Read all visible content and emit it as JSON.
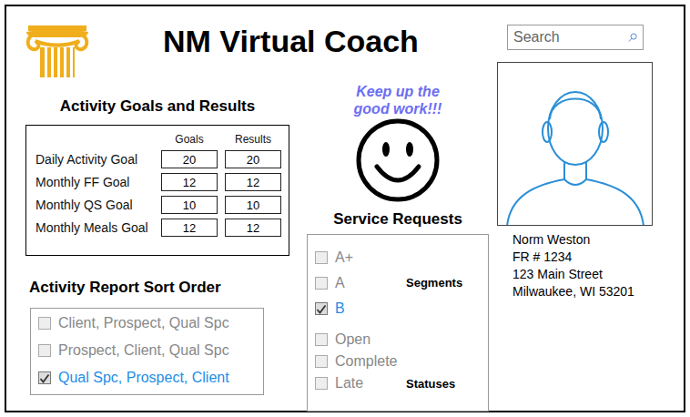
{
  "app": {
    "title": "NM Virtual Coach"
  },
  "search": {
    "placeholder": "Search"
  },
  "greeting": "Keep up the good work!!!",
  "activity_goals": {
    "title": "Activity Goals and Results",
    "columns": [
      "Goals",
      "Results"
    ],
    "rows": [
      {
        "label": "Daily Activity Goal",
        "goal": "20",
        "result": "20"
      },
      {
        "label": "Monthly FF Goal",
        "goal": "12",
        "result": "12"
      },
      {
        "label": "Monthly QS Goal",
        "goal": "10",
        "result": "10"
      },
      {
        "label": "Monthly Meals Goal",
        "goal": "12",
        "result": "12"
      }
    ]
  },
  "sort_order": {
    "title": "Activity Report Sort Order",
    "options": [
      {
        "label": "Client, Prospect, Qual Spc",
        "checked": false
      },
      {
        "label": "Prospect, Client, Qual Spc",
        "checked": false
      },
      {
        "label": "Qual Spc, Prospect, Client",
        "checked": true
      }
    ]
  },
  "service_requests": {
    "title": "Service Requests",
    "groups": [
      {
        "label": "Segments",
        "items": [
          {
            "label": "A+",
            "checked": false
          },
          {
            "label": "A",
            "checked": false
          },
          {
            "label": "B",
            "checked": true
          }
        ]
      },
      {
        "label": "Statuses",
        "items": [
          {
            "label": "Open",
            "checked": false
          },
          {
            "label": "Complete",
            "checked": false
          },
          {
            "label": "Late",
            "checked": false
          }
        ]
      }
    ]
  },
  "profile": {
    "lines": [
      "Norm Weston",
      "FR # 1234",
      "123 Main Street",
      "Milwaukee, WI 53201"
    ]
  }
}
